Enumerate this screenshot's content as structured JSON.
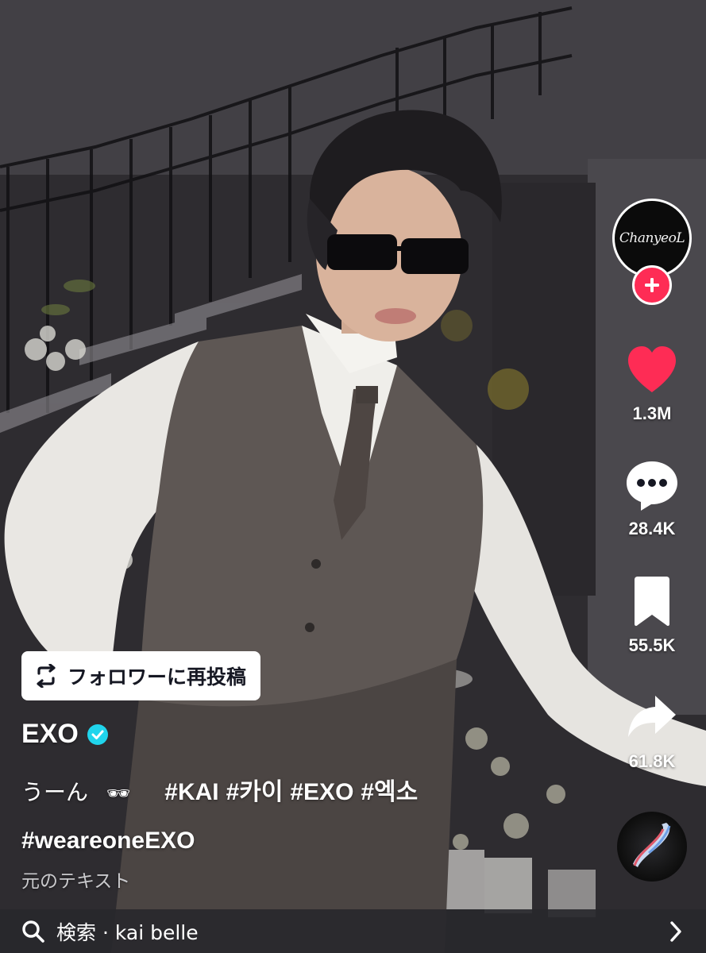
{
  "creator": {
    "avatar_text": "ChanyeoL"
  },
  "actions": {
    "likes": "1.3M",
    "comments": "28.4K",
    "saves": "55.5K",
    "shares": "61.8K"
  },
  "repost": {
    "label": "フォロワーに再投稿"
  },
  "post": {
    "author": "EXO",
    "caption_text": "うーん",
    "caption_emoji": "🕶",
    "hashtags": [
      "#KAI",
      "#카이",
      "#EXO",
      "#엑소",
      "#weareoneEXO"
    ],
    "translate_label": "元のテキスト"
  },
  "search": {
    "prefix": "検索",
    "separator": " · ",
    "query": "kai belle"
  },
  "colors": {
    "like_red": "#fe2c55",
    "verified_blue": "#20d5ec",
    "overlay_text": "#ffffff"
  },
  "icons": {
    "repost": "repost-arrows-icon",
    "verified": "verified-check-icon",
    "like": "heart-icon",
    "comment": "comment-bubble-icon",
    "save": "bookmark-icon",
    "share": "share-arrow-icon",
    "search": "search-icon",
    "chevron": "chevron-right-icon"
  }
}
